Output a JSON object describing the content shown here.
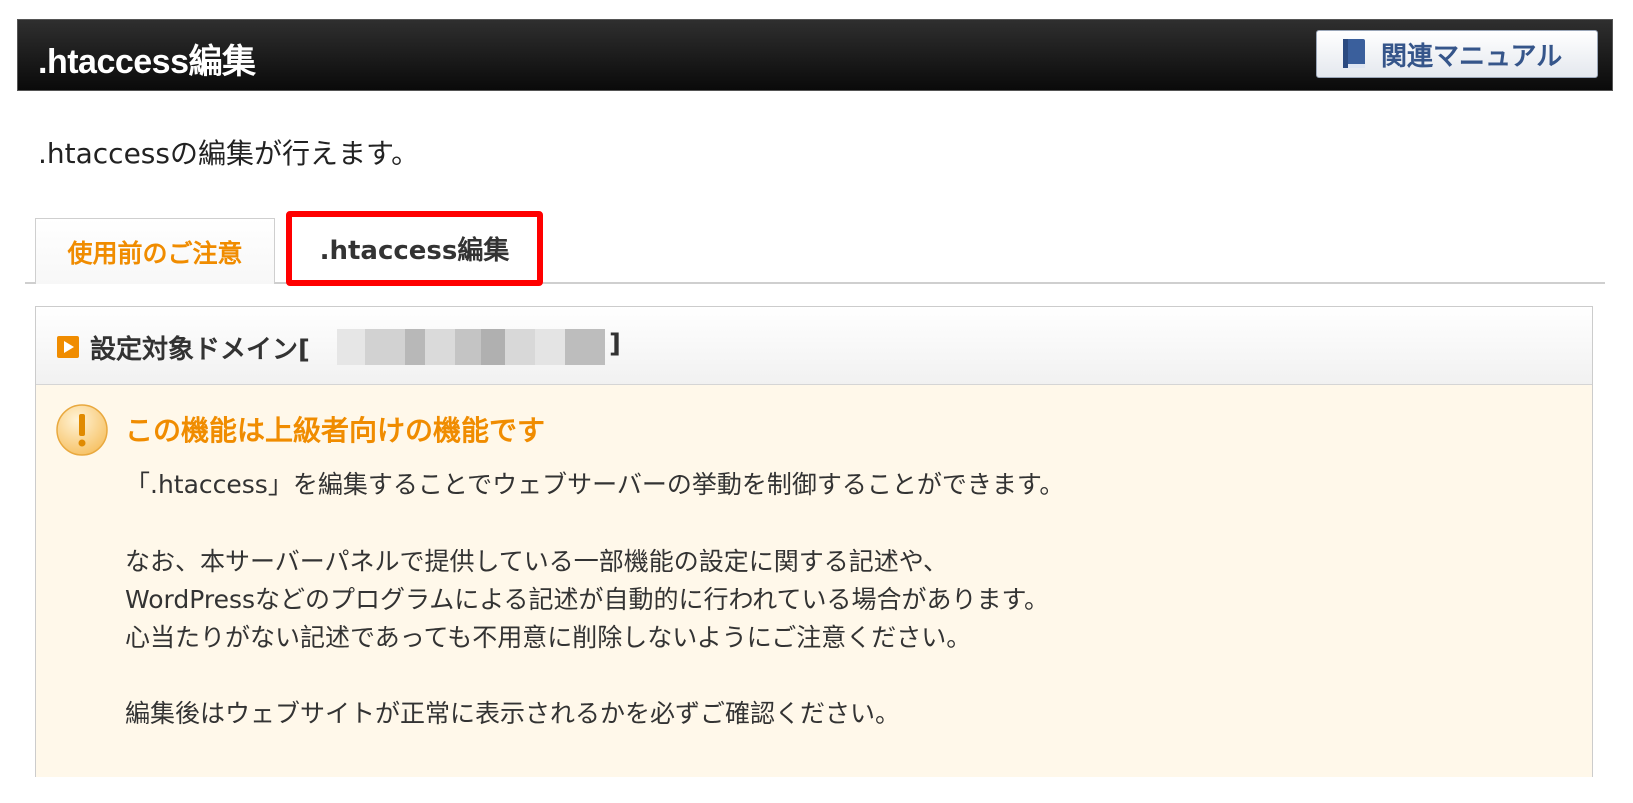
{
  "header": {
    "title": ".htaccess編集",
    "manual_button": "関連マニュアル",
    "manual_icon": "book-icon"
  },
  "intro": ".htaccessの編集が行えます。",
  "tabs": [
    {
      "label": "使用前のご注意",
      "active": true
    },
    {
      "label": ".htaccess編集",
      "highlighted": true
    }
  ],
  "domain": {
    "label": "設定対象ドメイン[",
    "close_bracket": "]",
    "icon": "play-icon"
  },
  "notice": {
    "icon": "warning-icon",
    "title": "この機能は上級者向けの機能です",
    "lines": [
      "「.htaccess」を編集することでウェブサーバーの挙動を制御することができます。",
      "なお、本サーバーパネルで提供している一部機能の設定に関する記述や、",
      "WordPressなどのプログラムによる記述が自動的に行われている場合があります。",
      "心当たりがない記述であっても不用意に削除しないようにご注意ください。",
      "編集後はウェブサイトが正常に表示されるかを必ずご確認ください。"
    ]
  },
  "colors": {
    "accent_orange": "#f08c00",
    "header_bg": "#1a1a1a",
    "notice_bg": "#fff8ea",
    "highlight_red": "#ff0000",
    "manual_text": "#35558a"
  }
}
